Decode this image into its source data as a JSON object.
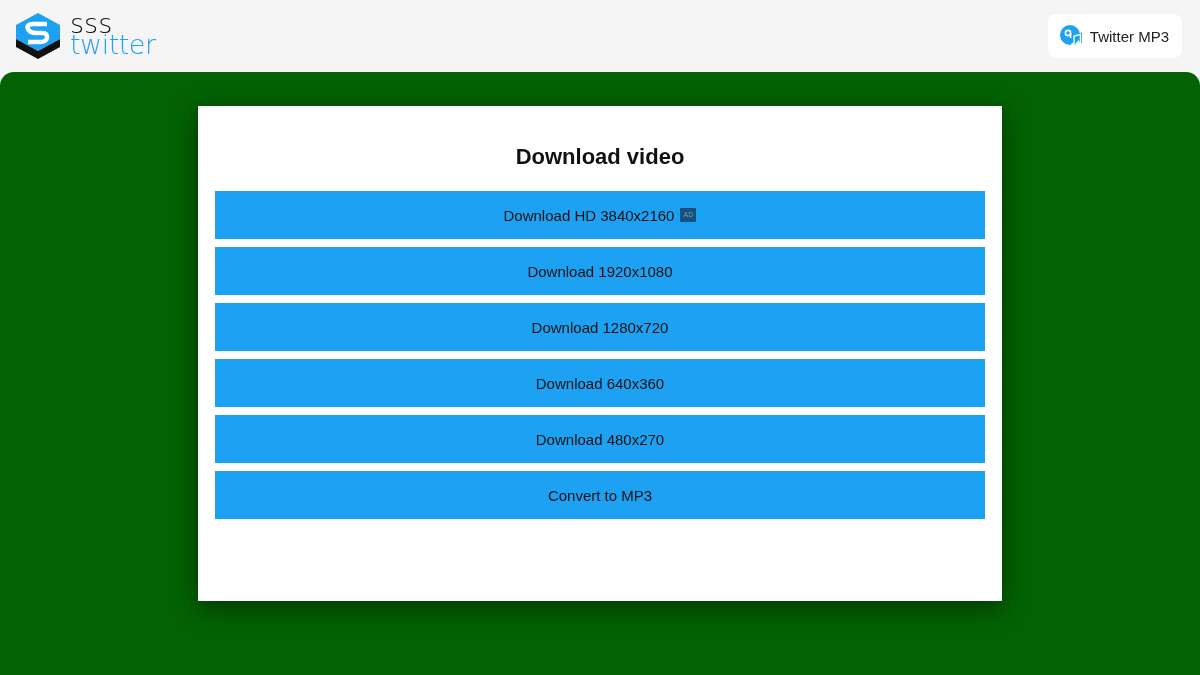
{
  "header": {
    "logo": {
      "top_word": "sss",
      "bottom_word": "twitter"
    },
    "mp3_link": {
      "label": "Twitter MP3"
    }
  },
  "download_panel": {
    "title": "Download video",
    "options": [
      {
        "label": "Download HD 3840x2160",
        "tag": "AD"
      },
      {
        "label": "Download 1920x1080"
      },
      {
        "label": "Download 1280x720"
      },
      {
        "label": "Download 640x360"
      },
      {
        "label": "Download 480x270"
      },
      {
        "label": "Convert to MP3"
      }
    ]
  }
}
